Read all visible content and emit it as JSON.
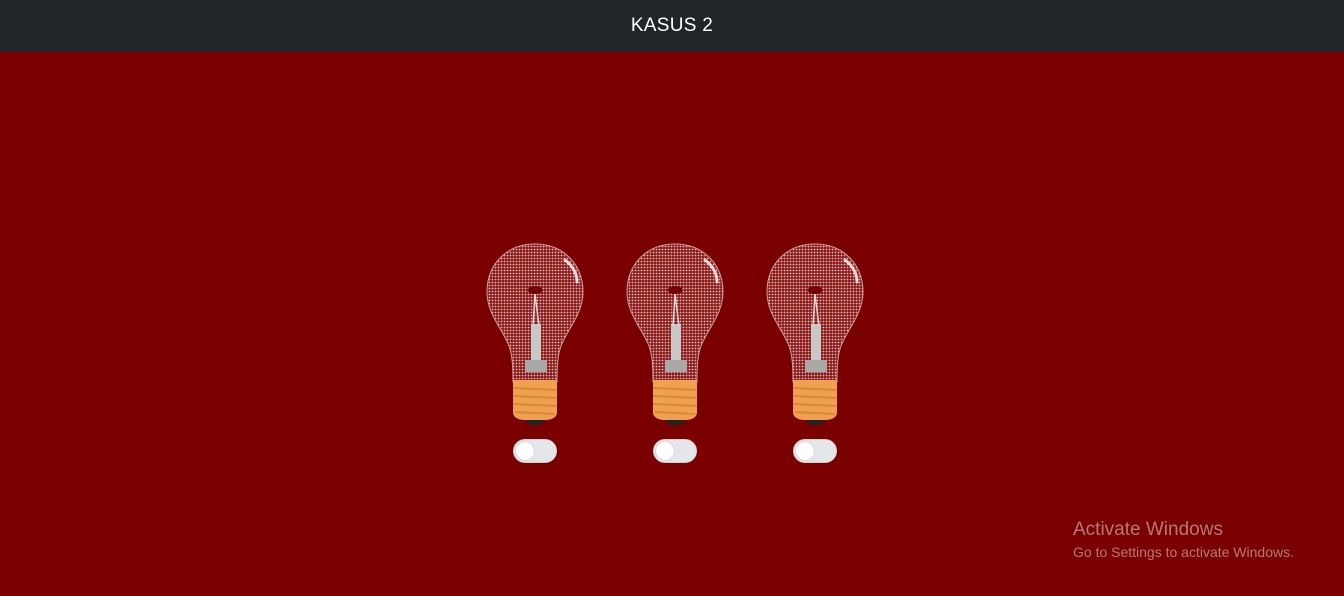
{
  "header": {
    "title": "KASUS 2"
  },
  "lamps": [
    {
      "icon": "light-bulb-icon",
      "switch_on": false
    },
    {
      "icon": "light-bulb-icon",
      "switch_on": false
    },
    {
      "icon": "light-bulb-icon",
      "switch_on": false
    }
  ],
  "watermark": {
    "title": "Activate Windows",
    "subtitle": "Go to Settings to activate Windows."
  },
  "colors": {
    "background": "#7a0000",
    "header": "#212529",
    "bulb_base": "#f0a050"
  }
}
